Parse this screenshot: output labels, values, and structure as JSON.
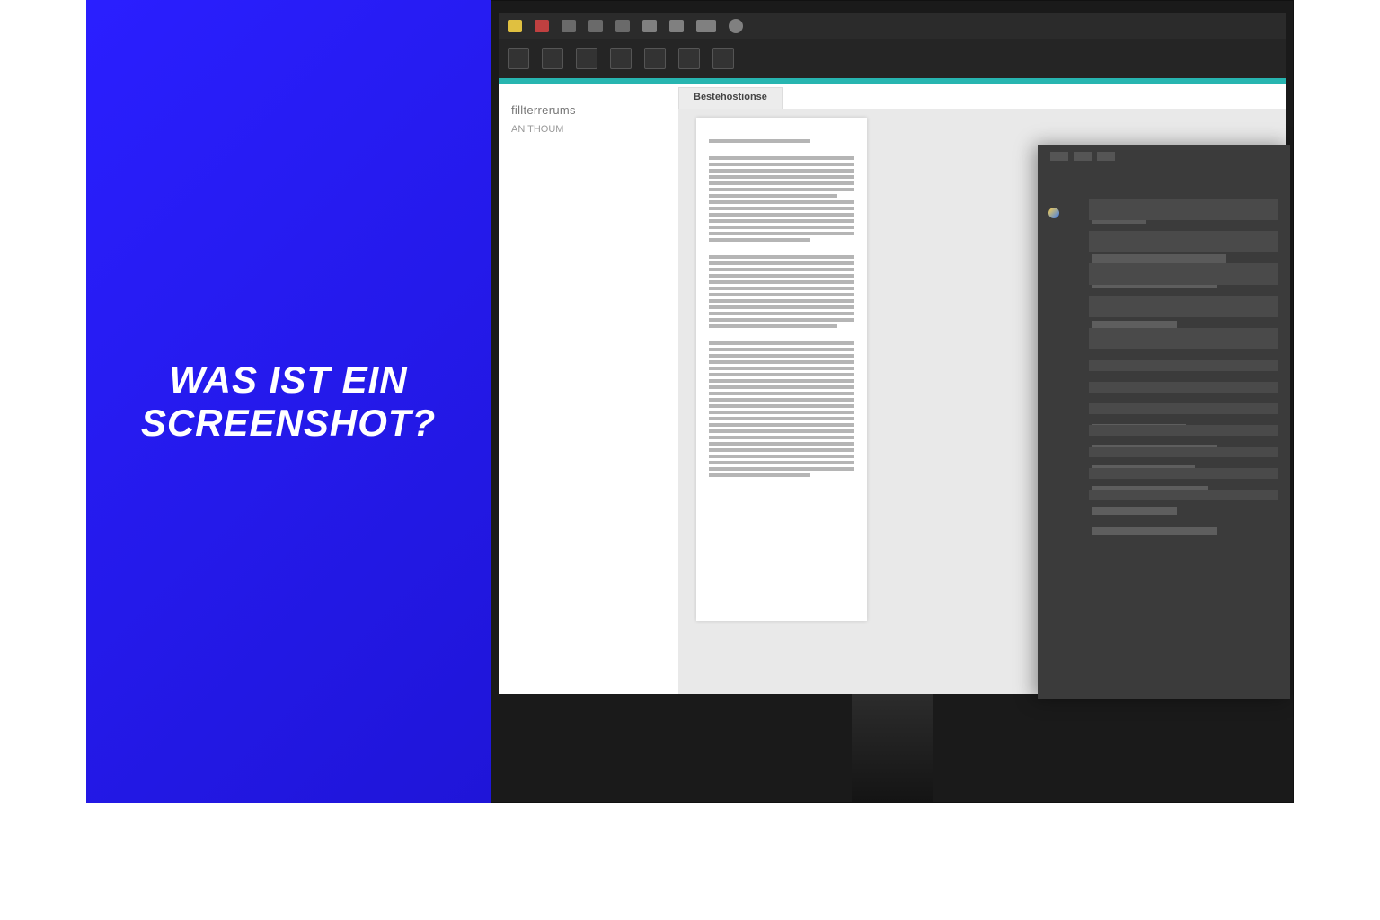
{
  "left": {
    "headline": "WAS IST EIN SCREENSHOT?"
  },
  "workspace": {
    "nav_title": "fillterrerums",
    "nav_sub": "AN THOUM",
    "tab_label": "Bestehostionse"
  }
}
